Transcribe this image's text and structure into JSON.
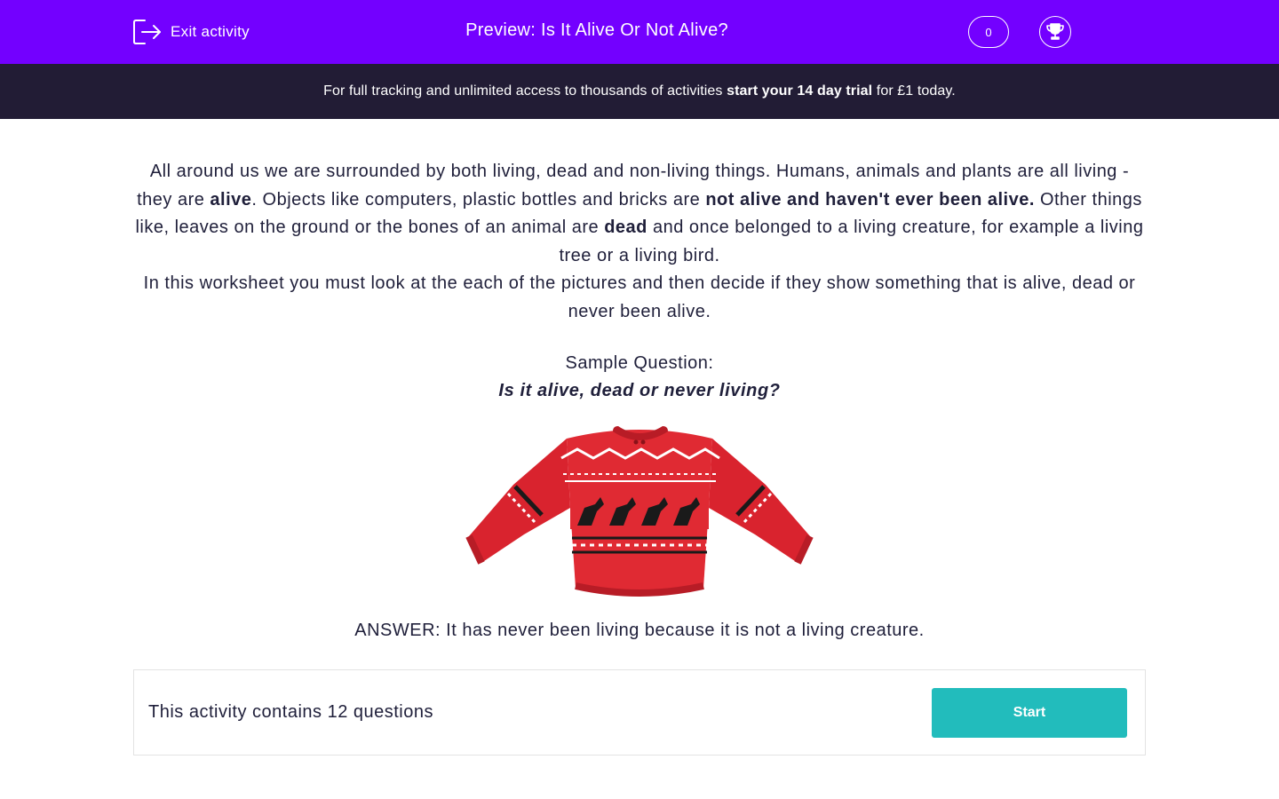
{
  "header": {
    "exit_label": "Exit activity",
    "title": "Preview: Is It Alive Or Not Alive?",
    "score": "0",
    "exit_icon": "exit-icon",
    "trophy_icon": "trophy-icon"
  },
  "banner": {
    "prefix": "For full tracking and unlimited access to thousands of activities ",
    "link": "start your 14 day trial",
    "suffix": " for £1 today."
  },
  "intro": {
    "p1_a": "All around us we are surrounded by both living, dead and non-living things. Humans, animals and plants are all living - they are ",
    "p1_b": "alive",
    "p1_c": ". Objects like computers, plastic bottles and bricks are ",
    "p1_d": "not alive and haven't ever been alive.",
    "p1_e": " Other things like, leaves on the ground or the bones of an animal are ",
    "p1_f": "dead",
    "p1_g": " and once belonged to a living creature, for example a living tree or a living bird.",
    "p2": "In this worksheet you must look at the each of the pictures and then decide if they show something that is alive, dead or never been alive."
  },
  "sample": {
    "label": "Sample Question:",
    "question": "Is it alive, dead or never living?",
    "image": "red-christmas-jumper-picture",
    "answer": "ANSWER: It has never been living because it is not a living creature."
  },
  "activity": {
    "count_text": "This activity contains 12 questions",
    "start_label": "Start"
  },
  "colors": {
    "header_bg": "#7300ff",
    "banner_bg": "#221c35",
    "start_bg": "#22bcbc",
    "text": "#1f1f3a"
  }
}
